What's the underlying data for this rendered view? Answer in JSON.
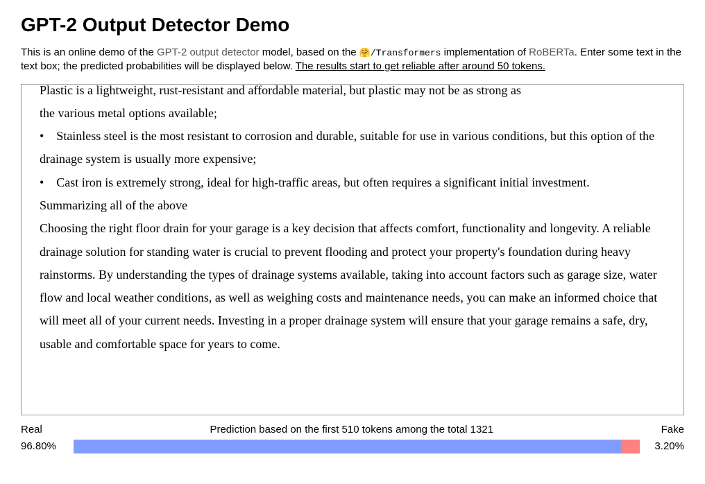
{
  "title": "GPT-2 Output Detector Demo",
  "desc": {
    "part1": "This is an online demo of the ",
    "link1": "GPT-2 output detector",
    "part2": " model, based on the ",
    "mono": "🤗/Transformers",
    "part3": " implementation of ",
    "link2": "RoBERTa",
    "part4": ". Enter some text in the text box; the predicted probabilities will be displayed below. ",
    "underline": "The results start to get reliable after around 50 tokens."
  },
  "content": {
    "line0": "Plastic is a lightweight, rust-resistant and affordable material, but plastic may not be as strong as",
    "line1": "the various metal options available;",
    "bullet1": "• Stainless steel is the most resistant to corrosion and durable, suitable for use in various conditions, but this option of the drainage system is usually more expensive;",
    "bullet2": "• Cast iron is extremely strong, ideal for high-traffic areas, but often requires a significant initial investment.",
    "heading": "Summarizing all of the above",
    "para": "Choosing the right floor drain for your garage is a key decision that affects comfort, functionality and longevity. A reliable drainage solution for standing water is crucial to prevent flooding and protect your property's foundation during heavy rainstorms. By understanding the types of drainage systems available, taking into account factors such as garage size, water flow and local weather conditions, as well as weighing costs and maintenance needs, you can make an informed choice that will meet all of your current needs. Investing in a proper drainage system will ensure that your garage remains a safe, dry, usable and comfortable space for years to come."
  },
  "results": {
    "real_label": "Real",
    "fake_label": "Fake",
    "prediction_text": "Prediction based on the first 510 tokens among the total 1321",
    "real_pct": "96.80%",
    "fake_pct": "3.20%",
    "real_width": 96.8,
    "fake_width": 3.2
  }
}
